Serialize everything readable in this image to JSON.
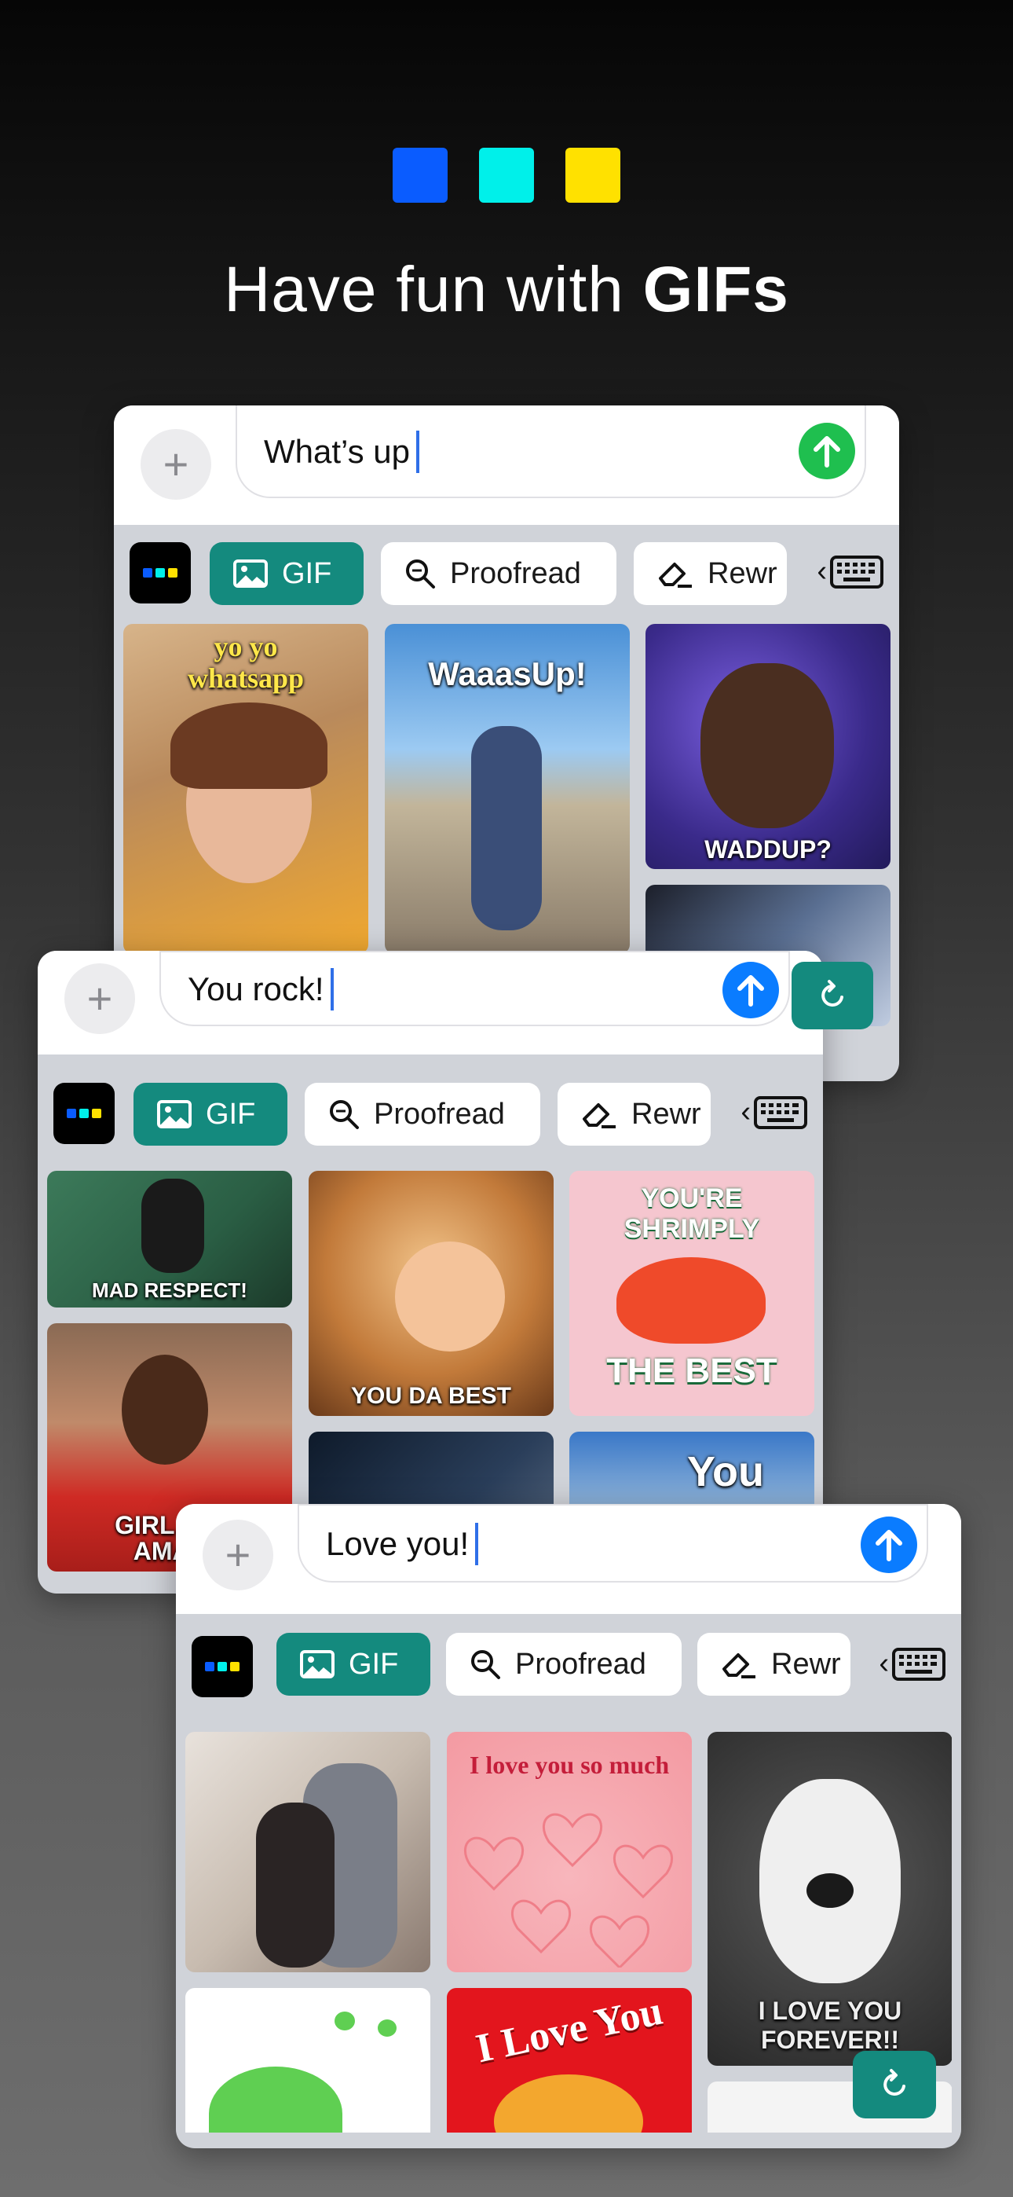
{
  "header": {
    "swatches": [
      "#0a5cff",
      "#00f0ea",
      "#ffe100"
    ],
    "headline_regular": "Have fun with ",
    "headline_bold": "GIFs"
  },
  "toolbar": {
    "gif_label": "GIF",
    "proofread_label": "Proofread",
    "rewrite_label": "Rewr"
  },
  "cards": [
    {
      "message": "What’s up",
      "send_color": "#1fbf4f",
      "gifs": [
        {
          "caption": "yo yo\nwhatsapp"
        },
        {
          "caption": "WaaasUp!"
        },
        {
          "caption": "WADDUP?"
        },
        {
          "caption": ""
        }
      ]
    },
    {
      "message": "You rock!",
      "send_color": "#0a7cff",
      "gifs": [
        {
          "caption": "MAD RESPECT!"
        },
        {
          "caption": "YOU DA BEST"
        },
        {
          "caption": "YOU'RE\nSHRIMPLY"
        },
        {
          "caption": "THE BEST"
        },
        {
          "caption": "GIRL, YO\nAMAZ"
        },
        {
          "caption": "You"
        }
      ]
    },
    {
      "message": "Love you!",
      "send_color": "#0a7cff",
      "gifs": [
        {
          "caption": "I love you so much"
        },
        {
          "caption": "I LOVE YOU\nFOREVER!!"
        },
        {
          "caption": "I Love You"
        }
      ]
    }
  ],
  "colors": {
    "gif_chip": "#148a7e",
    "caret": "#2f6fe8"
  }
}
